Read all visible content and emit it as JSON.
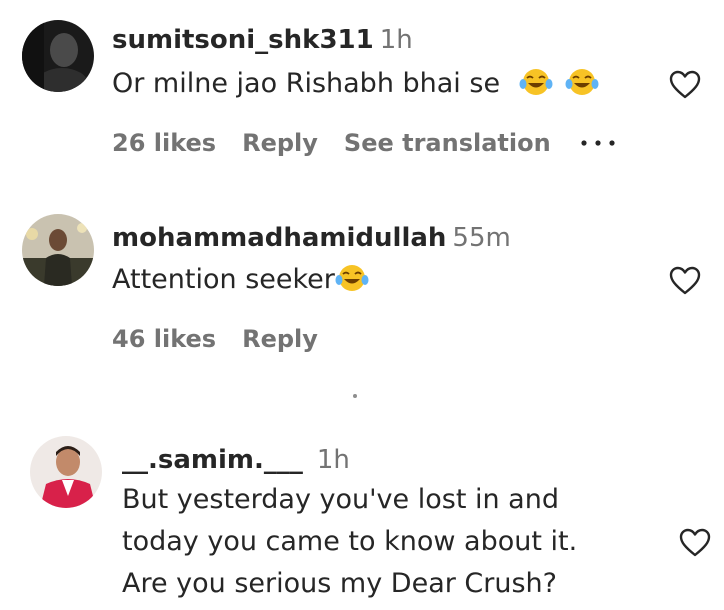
{
  "comments": [
    {
      "username": "sumitsoni_shk311",
      "time": "1h",
      "text": "Or milne jao Rishabh bhai se",
      "emoji": [
        "face-with-tears-of-joy-emoji",
        "face-with-tears-of-joy-emoji"
      ],
      "likes": "26 likes",
      "reply": "Reply",
      "translation": "See translation"
    },
    {
      "username": "mohammadhamidullah",
      "time": "55m",
      "text": "Attention seeker",
      "emoji": [
        "face-with-tears-of-joy-emoji"
      ],
      "likes": "46 likes",
      "reply": "Reply"
    },
    {
      "username": "__.samim.___",
      "time": "1h",
      "text_lines": [
        "But yesterday you've lost in and",
        "today you came to know about it.",
        "Are you serious my Dear Crush?"
      ]
    }
  ],
  "icons": {
    "like": "heart-outline-icon",
    "more": "more-horizontal-icon"
  },
  "colors": {
    "text": "#262626",
    "secondary": "#737373",
    "emoji_yellow": "#F7C325"
  }
}
